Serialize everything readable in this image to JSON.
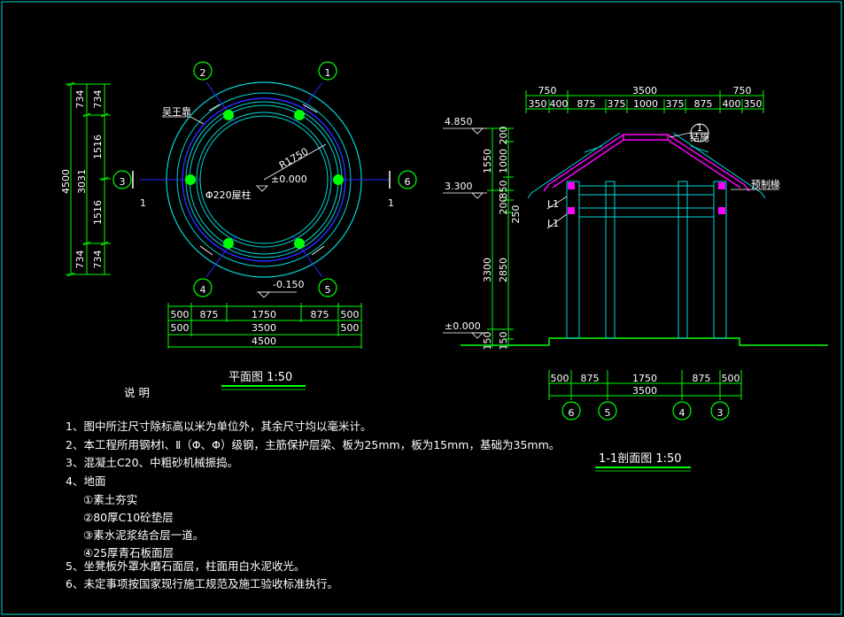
{
  "plan": {
    "title": "平面图  1:50",
    "axis_labels": {
      "a1": "1",
      "a2": "2",
      "a3": "3",
      "a4": "4",
      "a5": "5",
      "a6": "6"
    },
    "section_marks": {
      "left": "1",
      "right": "1"
    },
    "radius_label": "R1750",
    "center_level": "±0.000",
    "base_level": "-0.150",
    "column_label": "Φ220屋柱",
    "top_note": "吴王靠",
    "left_dims": {
      "total": "4500",
      "inner": "3031",
      "d734a": "734",
      "d734b": "734",
      "d1516a": "1516",
      "d1516b": "1516",
      "d734c": "734",
      "d734d": "734"
    },
    "bottom_row1": [
      "500",
      "875",
      "1750",
      "875",
      "500"
    ],
    "bottom_row2": [
      "500",
      "3500",
      "500"
    ],
    "bottom_total": "4500"
  },
  "section": {
    "title": "1-1剖面图  1:50",
    "top_row1": [
      "750",
      "3500",
      "750"
    ],
    "top_row2": [
      "350",
      "400",
      "875",
      "375",
      "1000",
      "375",
      "875",
      "400",
      "350"
    ],
    "levels": {
      "top": "4.850",
      "mid": "3.300",
      "ground": "±0.000"
    },
    "left_dims": {
      "d200": "200",
      "d1000": "1000",
      "d1550": "1550",
      "d350": "350",
      "d200b": "200",
      "d250": "250",
      "d3300": "3300",
      "d2850": "2850",
      "d150a": "150",
      "d150b": "150"
    },
    "beam_labels": {
      "l1a": "L1",
      "l1b": "L1"
    },
    "eave_label": "预制椽",
    "detail_num": "1",
    "detail_sub": "结施",
    "bottom_row1": [
      "500",
      "875",
      "1750",
      "875",
      "500"
    ],
    "bottom_total": "3500",
    "axis_labels": [
      "6",
      "5",
      "4",
      "3"
    ]
  },
  "notes": {
    "heading": "说    明",
    "items": [
      "1、图中所注尺寸除标高以米为单位外，其余尺寸均以毫米计。",
      "2、本工程所用钢材Ⅰ、Ⅱ（Φ、Φ）级钢，主筋保护层梁、板为25mm，板为15mm，基础为35mm。",
      "3、混凝土C20、中粗砂机械振捣。",
      "4、地面",
      "①素土夯实",
      "②80厚C10砼垫层",
      "③素水泥浆结合层一道。",
      "④25厚青石板面层",
      "5、坐凳板外罩水磨石面层，柱面用白水泥收光。",
      "6、未定事项按国家现行施工规范及施工验收标准执行。"
    ]
  },
  "colors": {
    "frame": "#00d8d8",
    "dim": "#00ff00",
    "text": "#ffffff",
    "ring": "#2a2aff",
    "magenta": "#ff00ff",
    "column": "#00ff00"
  }
}
